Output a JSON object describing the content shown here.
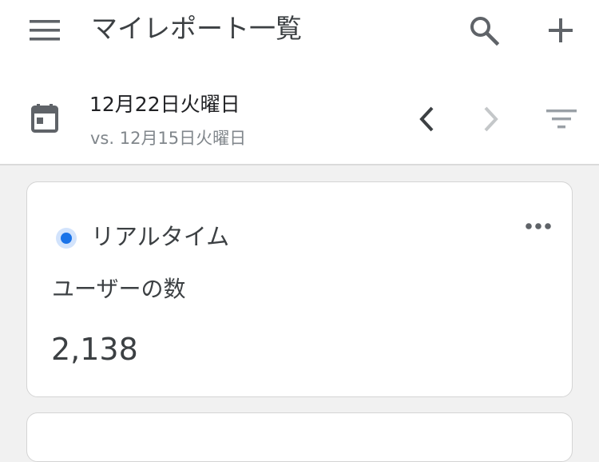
{
  "header": {
    "title": "マイレポート一覧",
    "menu_icon": "menu-icon",
    "search_icon": "search-icon",
    "add_icon": "plus-icon"
  },
  "date_bar": {
    "current_date": "12月22日火曜日",
    "compare_date": "vs. 12月15日火曜日",
    "calendar_icon": "calendar-icon",
    "prev_icon": "chevron-left-icon",
    "next_icon": "chevron-right-icon",
    "filter_icon": "filter-icon"
  },
  "realtime_card": {
    "title": "リアルタイム",
    "metric_label": "ユーザーの数",
    "metric_value": "2,138",
    "more_icon": "more-horiz-icon"
  },
  "colors": {
    "accent": "#1a73e8",
    "accent_light": "#d2e3fc",
    "text_primary": "#202124",
    "text_secondary": "#80868b",
    "background": "#f1f1f1",
    "disabled_icon": "#c4c7c9"
  }
}
